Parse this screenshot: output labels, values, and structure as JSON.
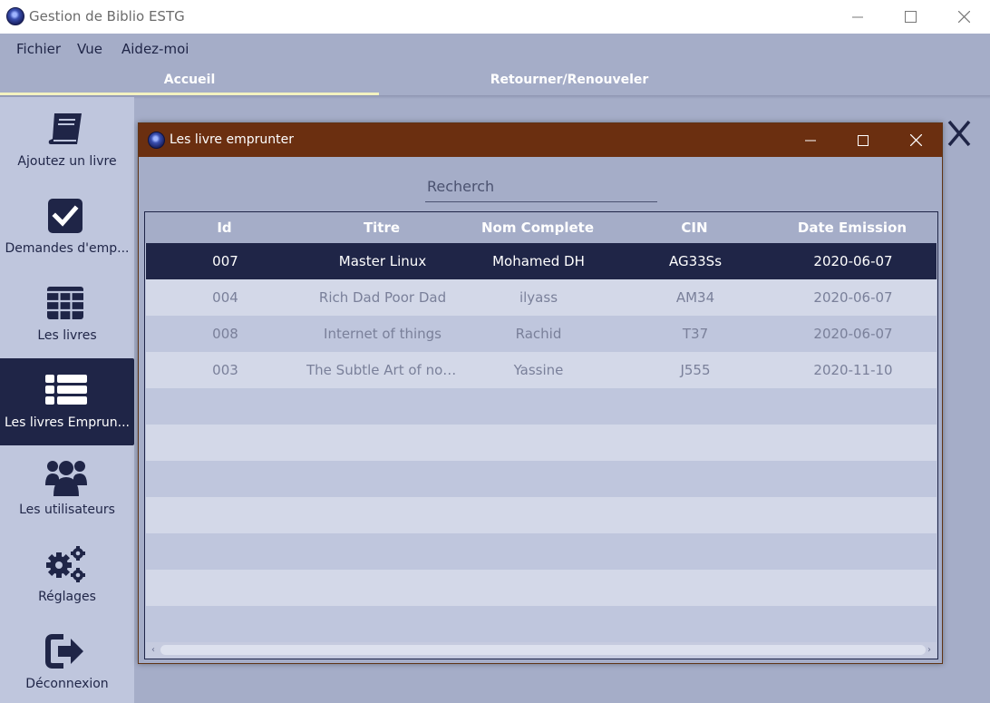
{
  "window": {
    "title": "Gestion de Biblio ESTG"
  },
  "menu": {
    "items": [
      "Fichier",
      "Vue",
      "Aidez-moi"
    ]
  },
  "tabs": [
    {
      "label": "Accueil",
      "active": true
    },
    {
      "label": "Retourner/Renouveler",
      "active": false
    }
  ],
  "sidebar": {
    "items": [
      {
        "label": "Ajoutez un livre",
        "icon": "book-icon"
      },
      {
        "label": "Demandes d'emp...",
        "icon": "checkbox-icon"
      },
      {
        "label": "Les livres",
        "icon": "grid-icon"
      },
      {
        "label": "Les livres Emprun...",
        "icon": "list-icon",
        "active": true
      },
      {
        "label": "Les utilisateurs",
        "icon": "users-icon"
      },
      {
        "label": "Réglages",
        "icon": "gears-icon"
      },
      {
        "label": "Déconnexion",
        "icon": "logout-icon"
      }
    ]
  },
  "dialog": {
    "title": "Les livre emprunter",
    "search_placeholder": "Recherch",
    "table": {
      "columns": [
        "Id",
        "Titre",
        "Nom Complete",
        "CIN",
        "Date Emission"
      ],
      "rows": [
        {
          "id": "007",
          "titre": "Master Linux",
          "nom": "Mohamed DH",
          "cin": "AG33Ss",
          "date": "2020-06-07",
          "selected": true
        },
        {
          "id": "004",
          "titre": "Rich Dad Poor Dad",
          "nom": "ilyass",
          "cin": "AM34",
          "date": "2020-06-07"
        },
        {
          "id": "008",
          "titre": "Internet of things",
          "nom": "Rachid",
          "cin": "T37",
          "date": "2020-06-07"
        },
        {
          "id": "003",
          "titre": "The Subtle Art of not ...",
          "nom": "Yassine",
          "cin": "J555",
          "date": "2020-11-10"
        }
      ],
      "empty_rows": 7
    }
  },
  "colors": {
    "navy": "#1f2547",
    "sidebar_bg": "#bfc6dd",
    "dialog_titlebar": "#6b2f10",
    "tab_underline": "#f3f2c0"
  }
}
